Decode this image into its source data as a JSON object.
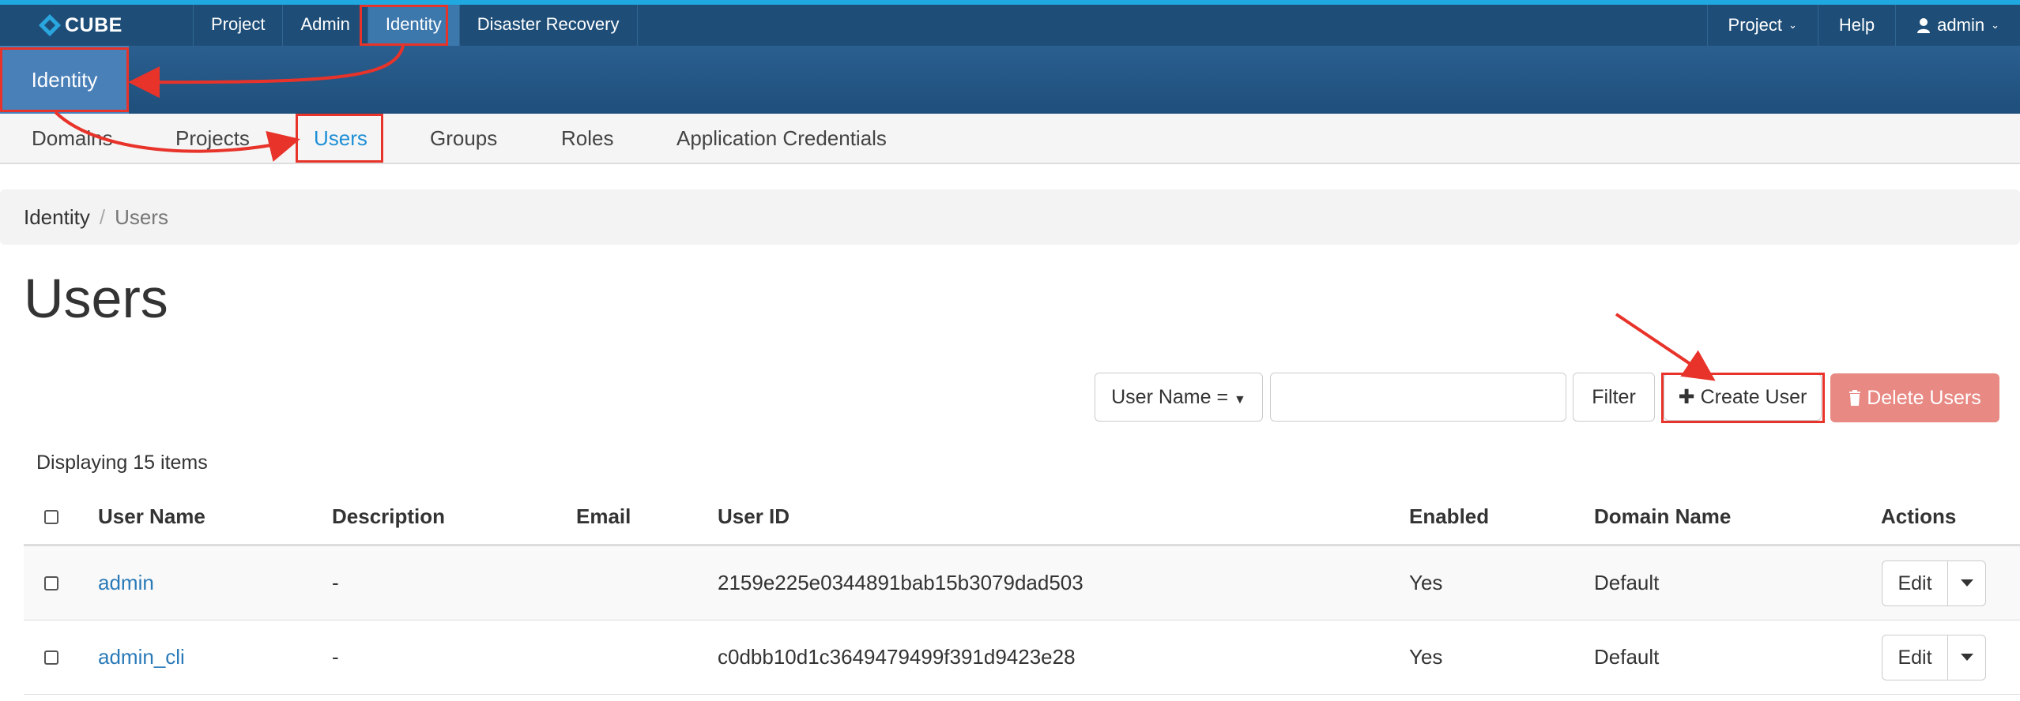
{
  "topbar": {
    "brand": "CUBE",
    "nav": [
      "Project",
      "Admin",
      "Identity",
      "Disaster Recovery"
    ],
    "right": {
      "project_label": "Project",
      "help_label": "Help",
      "user_label": "admin"
    }
  },
  "subheader": {
    "identity_label": "Identity"
  },
  "tabs": [
    "Domains",
    "Projects",
    "Users",
    "Groups",
    "Roles",
    "Application Credentials"
  ],
  "breadcrumb": {
    "home": "Identity",
    "separator": "/",
    "current": "Users"
  },
  "page_title": "Users",
  "actions": {
    "filter_select": "User Name =",
    "filter_input_value": "",
    "filter_button": "Filter",
    "create_button": "Create User",
    "delete_button": "Delete Users"
  },
  "count_text": "Displaying 15 items",
  "table": {
    "headers": [
      "User Name",
      "Description",
      "Email",
      "User ID",
      "Enabled",
      "Domain Name",
      "Actions"
    ],
    "rows": [
      {
        "name": "admin",
        "description": "-",
        "email": "",
        "user_id": "2159e225e0344891bab15b3079dad503",
        "enabled": "Yes",
        "domain": "Default",
        "action": "Edit"
      },
      {
        "name": "admin_cli",
        "description": "-",
        "email": "",
        "user_id": "c0dbb10d1c3649479499f391d9423e28",
        "enabled": "Yes",
        "domain": "Default",
        "action": "Edit"
      }
    ]
  },
  "colors": {
    "navbar": "#1e4e78",
    "accent": "#20a8e0",
    "active_tab": "#1e8fd6",
    "highlight": "#e8332a",
    "danger_button": "#e88983"
  }
}
